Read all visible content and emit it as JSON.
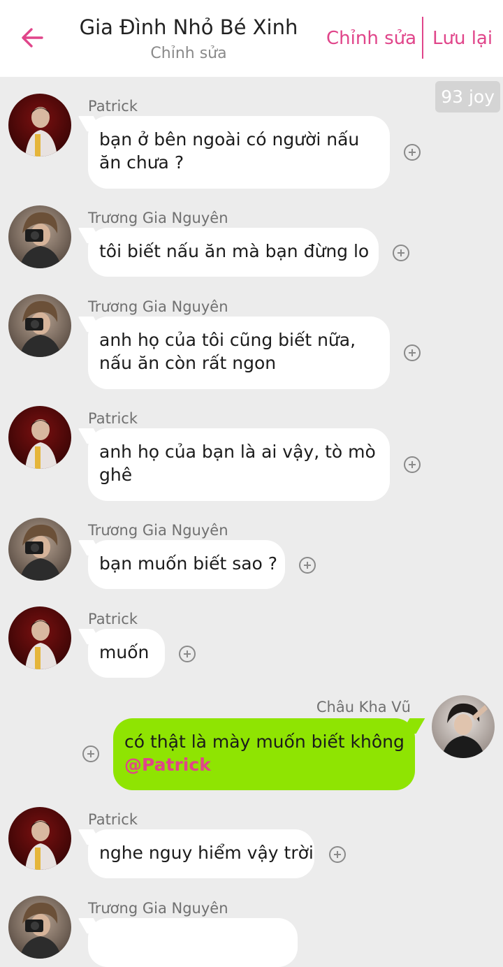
{
  "header": {
    "title": "Gia Đình Nhỏ Bé Xinh",
    "subtitle": "Chỉnh sửa",
    "edit_label": "Chỉnh sửa",
    "save_label": "Lưu lại"
  },
  "badge": {
    "joy_count": "93 joy"
  },
  "colors": {
    "accent": "#e0458a",
    "my_bubble": "#8fe402",
    "bubble": "#ffffff",
    "background": "#ececec"
  },
  "messages": [
    {
      "sender": "Patrick",
      "lines": [
        "bạn ở bên ngoài có người nấu",
        "ăn chưa ?"
      ]
    },
    {
      "sender": "Trương Gia Nguyên",
      "lines": [
        "tôi biết nấu ăn mà bạn đừng lo"
      ]
    },
    {
      "sender": "Trương Gia Nguyên",
      "lines": [
        "anh họ của tôi cũng biết nữa,",
        "nấu ăn còn rất ngon"
      ]
    },
    {
      "sender": "Patrick",
      "lines": [
        "anh họ của bạn là ai vậy, tò mò",
        "ghê"
      ]
    },
    {
      "sender": "Trương Gia Nguyên",
      "lines": [
        "bạn muốn biết sao ?"
      ]
    },
    {
      "sender": "Patrick",
      "lines": [
        "muốn"
      ]
    },
    {
      "sender": "Châu Kha Vũ",
      "lines": [
        "có thật là mày muốn biết không"
      ],
      "mention": "@Patrick",
      "mine": true
    },
    {
      "sender": "Patrick",
      "lines": [
        "nghe nguy hiểm vậy trời"
      ]
    },
    {
      "sender": "Trương Gia Nguyên",
      "lines": []
    }
  ]
}
